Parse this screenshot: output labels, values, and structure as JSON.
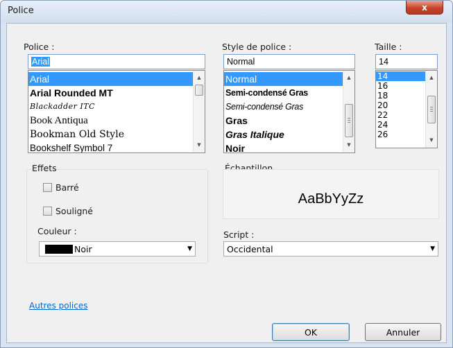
{
  "window": {
    "title": "Police",
    "close_label": "x"
  },
  "font": {
    "label": "Police :",
    "value": "Arial",
    "items": [
      {
        "label": "Arial",
        "selected": true
      },
      {
        "label": "Arial Rounded MT"
      },
      {
        "label": "Blackadder ITC"
      },
      {
        "label": "Book Antiqua"
      },
      {
        "label": "Bookman Old Style"
      },
      {
        "label": "Bookshelf Symbol 7"
      }
    ]
  },
  "style": {
    "label": "Style de police :",
    "value": "Normal",
    "items": [
      {
        "label": "Normal",
        "selected": true
      },
      {
        "label": "Semi-condensé Gras"
      },
      {
        "label": "Semi-condensé Gras"
      },
      {
        "label": "Gras"
      },
      {
        "label": "Gras Italique"
      },
      {
        "label": "Noir"
      }
    ]
  },
  "size": {
    "label": "Taille :",
    "value": "14",
    "items": [
      {
        "label": "14",
        "selected": true
      },
      {
        "label": "16"
      },
      {
        "label": "18"
      },
      {
        "label": "20"
      },
      {
        "label": "22"
      },
      {
        "label": "24"
      },
      {
        "label": "26"
      }
    ]
  },
  "effects": {
    "label": "Effets",
    "strikeout_label": "Barré",
    "underline_label": "Souligné",
    "color_label": "Couleur :",
    "color_value": "Noir",
    "color_hex": "#000000"
  },
  "sample": {
    "label": "Échantillon",
    "text": "AaBbYyZz"
  },
  "script": {
    "label": "Script :",
    "value": "Occidental"
  },
  "more_fonts_link": "Autres polices",
  "buttons": {
    "ok": "OK",
    "cancel": "Annuler"
  }
}
